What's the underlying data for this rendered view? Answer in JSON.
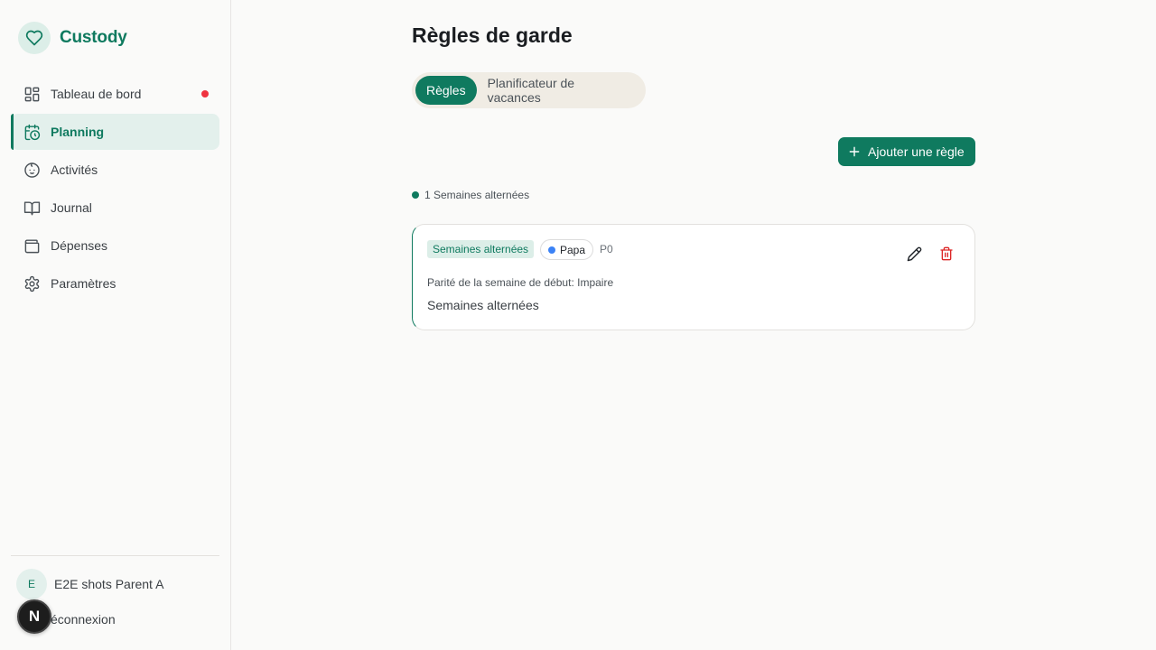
{
  "brand": {
    "name": "Custody",
    "icon": "heart-icon"
  },
  "sidebar": {
    "items": [
      {
        "label": "Tableau de bord",
        "icon": "dashboard-grid-icon",
        "notification": true
      },
      {
        "label": "Planning",
        "icon": "calendar-clock-icon",
        "active": true
      },
      {
        "label": "Activités",
        "icon": "baby-face-icon"
      },
      {
        "label": "Journal",
        "icon": "book-open-icon"
      },
      {
        "label": "Dépenses",
        "icon": "wallet-icon"
      },
      {
        "label": "Paramètres",
        "icon": "gear-icon"
      }
    ],
    "user": {
      "avatar_initial": "E",
      "name": "E2E shots Parent A"
    },
    "logout_label": "éconnexion",
    "dev_badge": "N"
  },
  "main": {
    "title": "Règles de garde",
    "tabs": [
      {
        "label": "Règles",
        "active": true
      },
      {
        "label": "Planificateur de vacances",
        "active": false
      }
    ],
    "add_rule_label": "Ajouter une règle",
    "legend_label": "1 Semaines alternées",
    "rules": [
      {
        "type": "Semaines alternées",
        "parent": "Papa",
        "priority": "P0",
        "detail": "Parité de la semaine de début: Impaire",
        "description": "Semaines alternées"
      }
    ]
  },
  "colors": {
    "accent": "#0f7a5f",
    "accent_light": "#e3f0ec",
    "notification": "#ef3340",
    "parent_dot": "#3b82f6",
    "delete": "#dc2626"
  }
}
